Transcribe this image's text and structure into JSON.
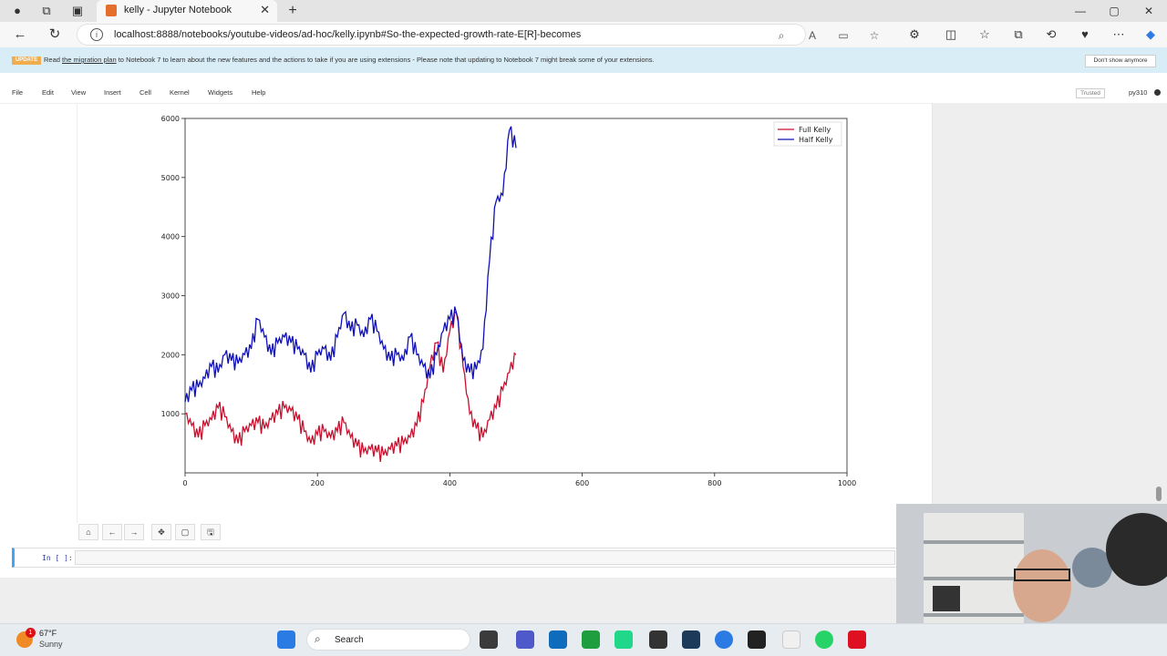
{
  "browser": {
    "tab_title": "kelly - Jupyter Notebook",
    "tab_close": "✕",
    "new_tab": "+",
    "url": "localhost:8888/notebooks/youtube-videos/ad-hoc/kelly.ipynb#So-the-expected-growth-rate-E[R]-becomes",
    "window_controls": [
      "—",
      "▢",
      "✕"
    ]
  },
  "banner": {
    "badge": "UPDATE",
    "msg_prefix": "Read ",
    "msg_link": "the migration plan",
    "msg_suffix": " to Notebook 7 to learn about the new features and the actions to take if you are using extensions - Please note that updating to Notebook 7 might break some of your extensions.",
    "dismiss_label": "Don't show anymore"
  },
  "menubar": {
    "items": [
      "File",
      "Edit",
      "View",
      "Insert",
      "Cell",
      "Kernel",
      "Widgets",
      "Help"
    ],
    "trusted": "Trusted",
    "kernel": "py310"
  },
  "figure_toolbar": {
    "icons": [
      "home-icon",
      "back-arrow-icon",
      "forward-arrow-icon",
      "pan-icon",
      "zoom-rect-icon",
      "save-icon"
    ],
    "glyphs": [
      "⌂",
      "←",
      "→",
      "✥",
      "▢",
      "🖫"
    ]
  },
  "cell": {
    "prompt": "In [ ]:"
  },
  "taskbar": {
    "weather_badge": "1",
    "temp": "67°F",
    "cond": "Sunny",
    "search": "Search"
  },
  "colors": {
    "full_kelly": "#c8102e",
    "half_kelly": "#1010b8",
    "banner": "#d9edf7",
    "cell_border": "#42a5f5"
  },
  "chart_data": {
    "type": "line",
    "title": "",
    "xlabel": "",
    "ylabel": "",
    "xlim": [
      0,
      1000
    ],
    "ylim": [
      0,
      6000
    ],
    "xticks": [
      0,
      200,
      400,
      600,
      800,
      1000
    ],
    "yticks": [
      1000,
      2000,
      3000,
      4000,
      5000,
      6000
    ],
    "legend_position": "top-right",
    "x": [
      0,
      10,
      20,
      30,
      40,
      50,
      60,
      70,
      80,
      90,
      100,
      110,
      120,
      130,
      140,
      150,
      160,
      170,
      180,
      190,
      200,
      210,
      220,
      230,
      240,
      250,
      260,
      270,
      280,
      290,
      300,
      310,
      320,
      330,
      340,
      350,
      360,
      370,
      380,
      390,
      400,
      410,
      420,
      430,
      440,
      450,
      460,
      470,
      480,
      490,
      500
    ],
    "series": [
      {
        "name": "Full Kelly",
        "color": "#c8102e",
        "values": [
          1000,
          800,
          600,
          800,
          900,
          1100,
          950,
          700,
          500,
          700,
          800,
          850,
          750,
          900,
          1000,
          1100,
          1050,
          900,
          700,
          500,
          650,
          700,
          600,
          700,
          850,
          600,
          450,
          350,
          400,
          350,
          300,
          400,
          450,
          500,
          600,
          800,
          1200,
          1800,
          2200,
          1700,
          2400,
          2700,
          1800,
          1000,
          750,
          600,
          900,
          1100,
          1400,
          1700,
          2000
        ]
      },
      {
        "name": "Half Kelly",
        "color": "#1010b8",
        "values": [
          1200,
          1400,
          1450,
          1600,
          1800,
          1700,
          2000,
          1900,
          1850,
          2000,
          2100,
          2600,
          2300,
          2000,
          2200,
          2300,
          2200,
          2100,
          2000,
          1700,
          2000,
          2100,
          1900,
          2300,
          2700,
          2400,
          2500,
          2300,
          2600,
          2400,
          2100,
          1900,
          2000,
          1900,
          2300,
          2000,
          1800,
          1600,
          2000,
          2400,
          2600,
          2700,
          1900,
          1700,
          1750,
          2100,
          3600,
          4600,
          4700,
          5800,
          5500
        ]
      }
    ]
  }
}
